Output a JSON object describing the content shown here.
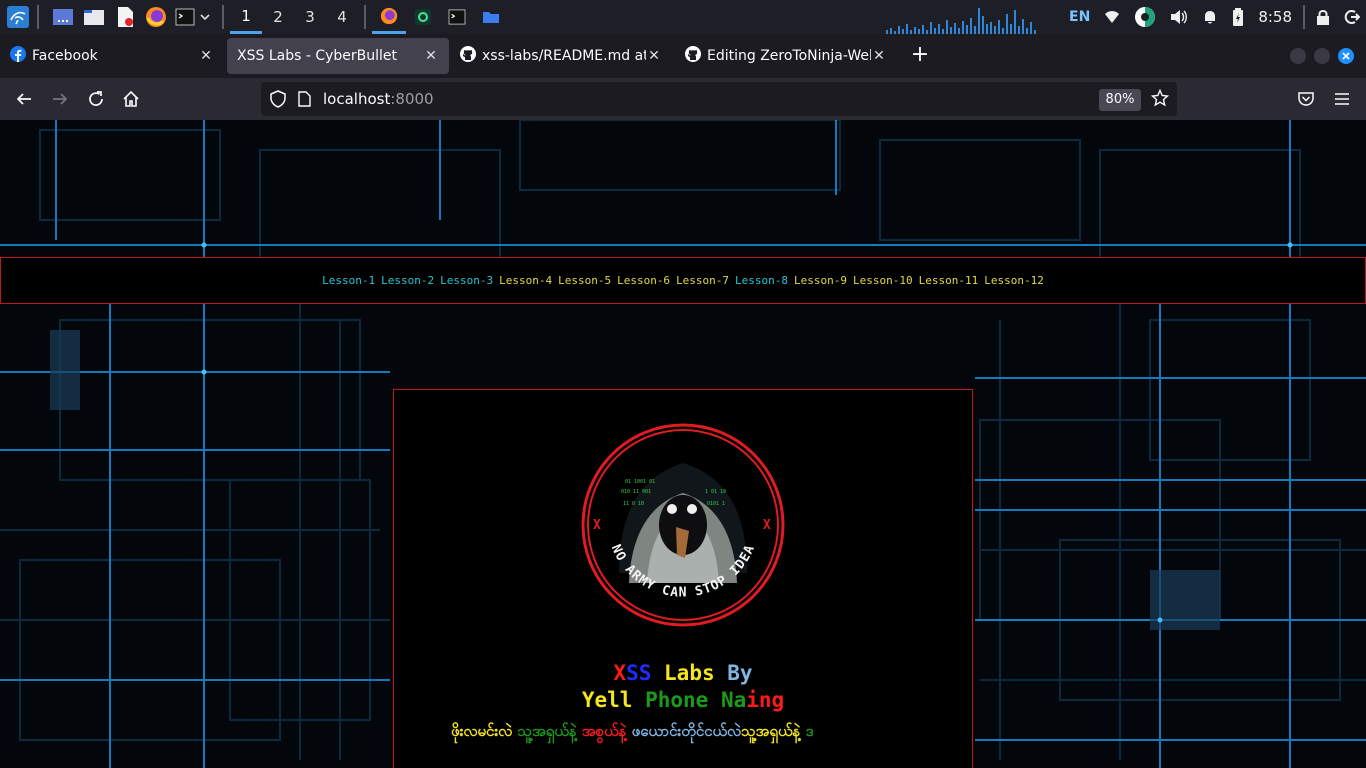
{
  "taskbar": {
    "workspaces": [
      "1",
      "2",
      "3",
      "4"
    ],
    "active_workspace": "1",
    "tray": {
      "language": "EN",
      "clock": "8:58"
    },
    "icons": [
      "kali-menu-icon",
      "desktop-icon",
      "file-manager-icon",
      "text-editor-icon",
      "firefox-icon",
      "terminal-icon"
    ]
  },
  "tabs": [
    {
      "title": "Facebook",
      "icon": "facebook-icon",
      "active": false
    },
    {
      "title": "XSS Labs - CyberBullet",
      "icon": "",
      "active": true
    },
    {
      "title": "xss-labs/README.md at m",
      "icon": "github-icon",
      "active": false
    },
    {
      "title": "Editing ZeroToNinja-Web",
      "icon": "github-icon",
      "active": false
    }
  ],
  "navbar": {
    "url_host": "localhost",
    "url_port": ":8000",
    "zoom": "80%"
  },
  "menu": {
    "lessons": [
      {
        "label": "Lesson-1",
        "color": "cyan"
      },
      {
        "label": "Lesson-2",
        "color": "cyan"
      },
      {
        "label": "Lesson-3",
        "color": "cyan"
      },
      {
        "label": "Lesson-4",
        "color": "yellow"
      },
      {
        "label": "Lesson-5",
        "color": "yellow"
      },
      {
        "label": "Lesson-6",
        "color": "yellow"
      },
      {
        "label": "Lesson-7",
        "color": "yellow"
      },
      {
        "label": "Lesson-8",
        "color": "cyan"
      },
      {
        "label": "Lesson-9",
        "color": "yellow"
      },
      {
        "label": "Lesson-10",
        "color": "yellow"
      },
      {
        "label": "Lesson-11",
        "color": "yellow"
      },
      {
        "label": "Lesson-12",
        "color": "yellow"
      }
    ]
  },
  "card": {
    "logo_text": "NO ARMY CAN STOP IDEA",
    "logo_marks": [
      "X",
      "X"
    ],
    "title": {
      "x": "X",
      "ss": "SS",
      "labs": "Labs",
      "by": "By"
    },
    "author": {
      "yell": "Yell",
      "phone": "Phone",
      "na": "Na",
      "ing": "ing"
    },
    "tagline": {
      "p1": "ဖိုးလမင်းလဲ",
      "p2": "သူ့အရှယ်နဲ့",
      "p3": "အစွယ်နဲ့",
      "p4": "ဖယောင်းတိုင်ငယ်လဲ",
      "p5": "သူ့အရှယ်နဲ့",
      "p6": "ဒ"
    }
  },
  "colors": {
    "accent_red": "#c0191b",
    "lesson_cyan": "#28c4d8",
    "lesson_yellow": "#e0d84a"
  }
}
